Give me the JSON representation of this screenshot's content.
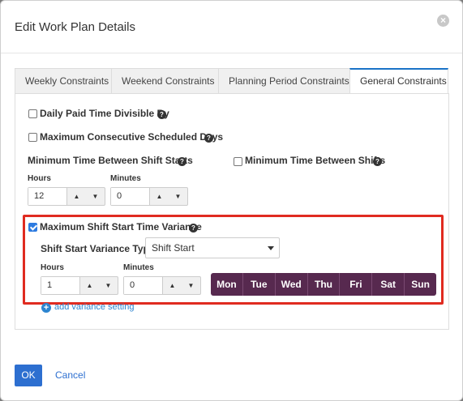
{
  "dialog": {
    "title": "Edit Work Plan Details",
    "close_icon": "×"
  },
  "tabs": [
    {
      "label": "Weekly Constraints"
    },
    {
      "label": "Weekend Constraints"
    },
    {
      "label": "Planning Period Constraints"
    },
    {
      "label": "General Constraints"
    }
  ],
  "general": {
    "daily_paid": "Daily Paid Time Divisible By",
    "max_consecutive": "Maximum Consecutive Scheduled Days",
    "min_between_starts": "Minimum Time Between Shift Starts",
    "min_between_shifts": "Minimum Time Between Shifts",
    "hours_label": "Hours",
    "minutes_label": "Minutes",
    "hours_value": "12",
    "minutes_value": "0"
  },
  "variance": {
    "label": "Maximum Shift Start Time Variance",
    "type_label": "Shift Start Variance Type",
    "type_value": "Shift Start",
    "hours_label": "Hours",
    "minutes_label": "Minutes",
    "hours_value": "1",
    "minutes_value": "0",
    "days": [
      "Mon",
      "Tue",
      "Wed",
      "Thu",
      "Fri",
      "Sat",
      "Sun"
    ],
    "add_link": "add variance setting"
  },
  "footer": {
    "ok": "OK",
    "cancel": "Cancel"
  },
  "icons": {
    "help": "?",
    "up": "▲",
    "down": "▼",
    "plus": "+"
  },
  "colors": {
    "accent": "#2d6fd0",
    "day_bar": "#57294f",
    "highlight": "#e02b20"
  }
}
